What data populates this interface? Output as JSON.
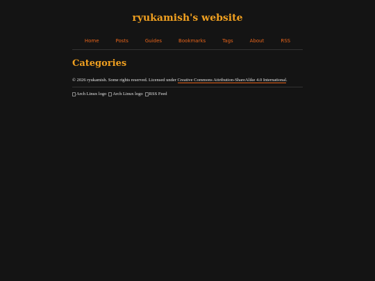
{
  "header": {
    "site_title": "ryukamish's website"
  },
  "nav": {
    "items": [
      {
        "label": "Home"
      },
      {
        "label": "Posts"
      },
      {
        "label": "Guides"
      },
      {
        "label": "Bookmarks"
      },
      {
        "label": "Tags"
      },
      {
        "label": "About"
      },
      {
        "label": "RSS"
      }
    ]
  },
  "main": {
    "heading": "Categories"
  },
  "footer": {
    "copyright_prefix": "© 2026 ryukamish. Some rights reserved. Licensed under ",
    "license_link": "Creative Commons Attribution-ShareAlike 4.0 International",
    "copyright_suffix": ".",
    "badges": [
      {
        "alt": "Arch Linux logo"
      },
      {
        "alt": "Arch Linux logo"
      },
      {
        "alt": "RSS Feed"
      }
    ]
  },
  "colors": {
    "background": "#141414",
    "accent_title": "#f0a020",
    "nav_link": "#e8641a",
    "body_text": "#e6e6e6"
  }
}
